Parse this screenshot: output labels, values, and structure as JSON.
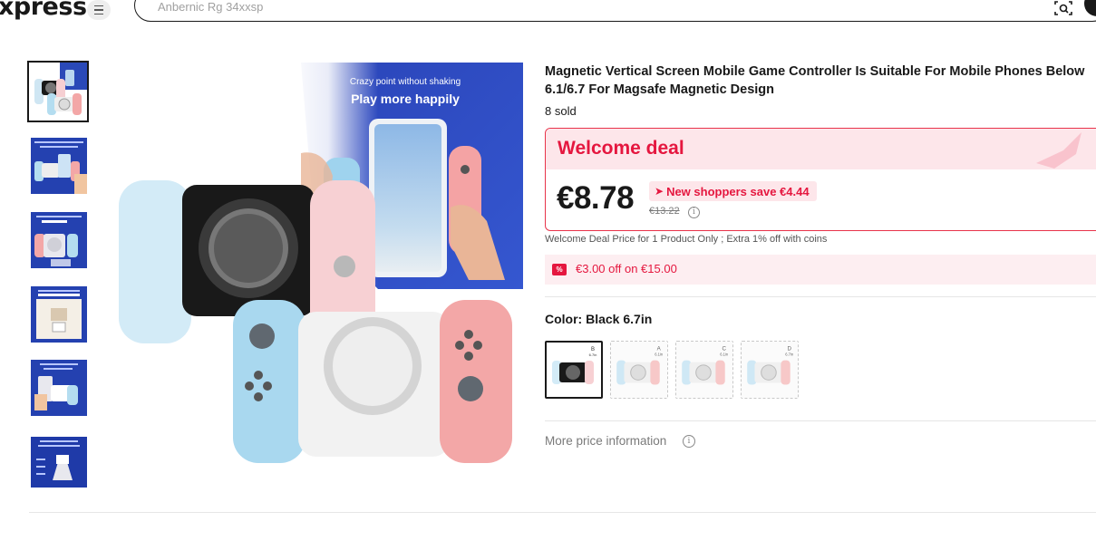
{
  "header": {
    "logo_text": "xpress",
    "search_placeholder": "Anbernic Rg 34xxsp",
    "icons": [
      "menu-icon",
      "image-search-icon",
      "search-icon"
    ]
  },
  "gallery": {
    "thumbnails": [
      {
        "label": "",
        "theme": "product-front",
        "active": true
      },
      {
        "label": "Strong magnetic suction",
        "theme": "blue-banner"
      },
      {
        "label": "Stable phone",
        "theme": "blue-banner"
      },
      {
        "label": "Compact and space saving",
        "theme": "blue-banner"
      },
      {
        "label": "Strong and sturdy",
        "theme": "blue-banner"
      },
      {
        "label": "Light weight",
        "theme": "blue-banner"
      }
    ],
    "main_image": {
      "headline_small": "Crazy point without shaking",
      "headline_big": "Play more happily"
    }
  },
  "product": {
    "title": "Magnetic Vertical Screen Mobile Game Controller Is Suitable For Mobile Phones Below 6.1/6.7 For Magsafe Magnetic Design",
    "sold": "8 sold",
    "deal": {
      "heading": "Welcome deal",
      "price": "€8.78",
      "save_badge": "New shoppers save €4.44",
      "old_price": "€13.22",
      "note": "Welcome Deal Price for 1 Product Only ; Extra 1% off with coins"
    },
    "coupon": {
      "icon_text": "%",
      "text": "€3.00 off on €15.00"
    },
    "color": {
      "label": "Color: Black 6.7in",
      "options": [
        {
          "tag": "B",
          "size": "6.7in",
          "status": "selected",
          "body_color": "#191919"
        },
        {
          "tag": "A",
          "size": "6.1in",
          "status": "unavailable",
          "body_color": "#f2f2f2"
        },
        {
          "tag": "C",
          "size": "6.1in",
          "status": "unavailable",
          "body_color": "#f2f2f2"
        },
        {
          "tag": "D",
          "size": "6.7in",
          "status": "unavailable",
          "body_color": "#f2f2f2"
        }
      ]
    },
    "more_price": "More price information"
  },
  "colors": {
    "accent_red": "#e5173f",
    "deal_bg": "#fde6ea",
    "text_dark": "#191919",
    "joycon_blue": "#a9d8ef",
    "joycon_pink": "#f7a9a9"
  }
}
